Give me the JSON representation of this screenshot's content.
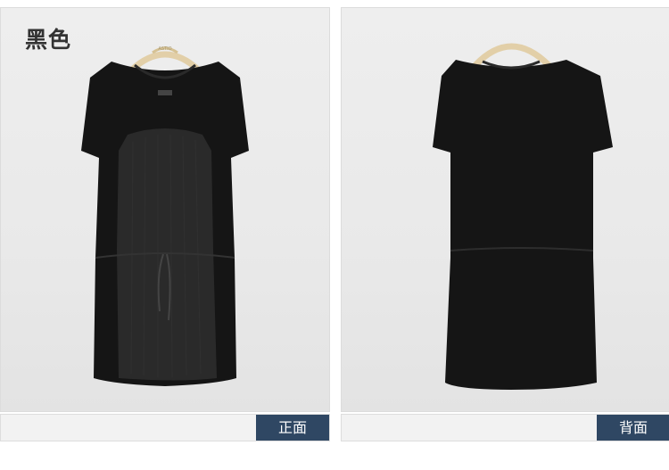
{
  "color_label": "黑色",
  "front_label": "正面",
  "back_label": "背面",
  "colors": {
    "tag_bg": "#2f4763",
    "garment": "#161616",
    "panel_fabric": "#2b2b2b"
  }
}
